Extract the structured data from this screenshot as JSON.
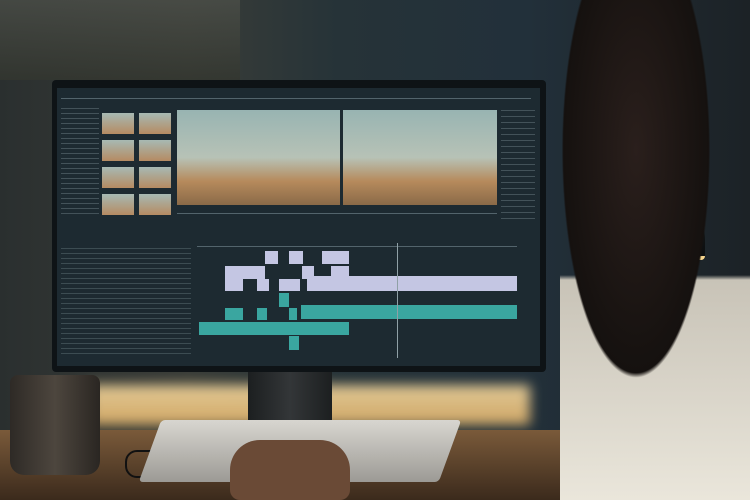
{
  "scene": {
    "description_tags": [
      "video-editing-monitor",
      "person",
      "desk-lamp",
      "mug",
      "keyboard"
    ],
    "colors": {
      "video_clip": "#c4c6e3",
      "audio_clip": "#3aa6a0",
      "editor_bg": "#1d2a31",
      "lamp_light": "#f7d58d"
    }
  }
}
